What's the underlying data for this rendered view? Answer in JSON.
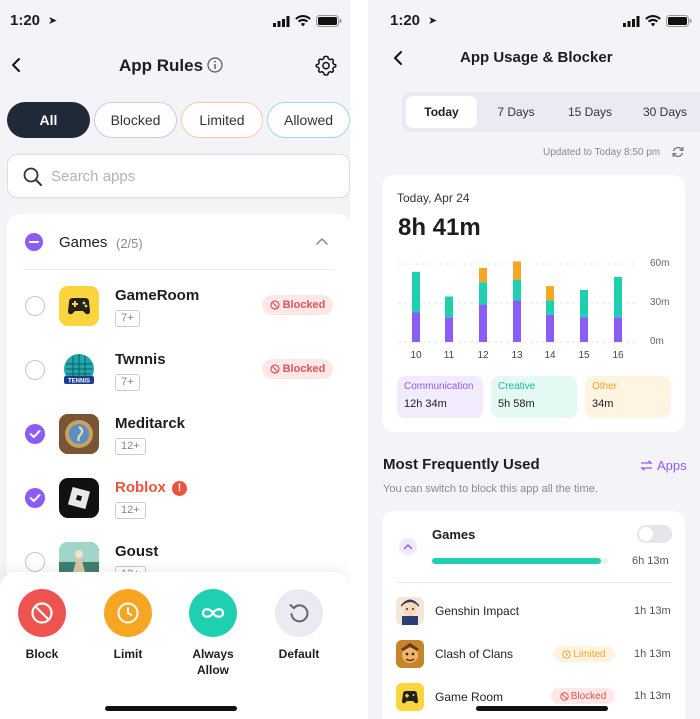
{
  "left": {
    "status_time": "1:20",
    "title": "App Rules",
    "filters": [
      {
        "label": "All",
        "active": true
      },
      {
        "label": "Blocked",
        "active": false
      },
      {
        "label": "Limited",
        "active": false
      },
      {
        "label": "Allowed",
        "active": false
      }
    ],
    "search_placeholder": "Search apps",
    "group": {
      "name": "Games",
      "count": "(2/5)"
    },
    "apps": [
      {
        "name": "GameRoom",
        "age": "7+",
        "checked": false,
        "badge": "Blocked"
      },
      {
        "name": "Twnnis",
        "age": "7+",
        "checked": false,
        "badge": "Blocked"
      },
      {
        "name": "Meditarck",
        "age": "12+",
        "checked": true,
        "badge": ""
      },
      {
        "name": "Roblox",
        "age": "12+",
        "checked": true,
        "badge": ""
      },
      {
        "name": "Goust",
        "age": "12+",
        "checked": false,
        "badge": ""
      }
    ],
    "actions": [
      {
        "label": "Block",
        "color": "#ef5350"
      },
      {
        "label": "Limit",
        "color": "#f5a623"
      },
      {
        "label": "Always Allow",
        "color": "#1fcfb0"
      },
      {
        "label": "Default",
        "color": "#ebeaf3"
      }
    ],
    "colors": {
      "accent": "#8b5cf6",
      "dark_pill": "#1f2937",
      "warning": "#e8543f"
    }
  },
  "right": {
    "status_time": "1:20",
    "title": "App Usage & Blocker",
    "periods": [
      {
        "label": "Today",
        "active": true
      },
      {
        "label": "7 Days",
        "active": false
      },
      {
        "label": "15 Days",
        "active": false
      },
      {
        "label": "30 Days",
        "active": false
      }
    ],
    "updated": "Updated to Today 8:50 pm",
    "summary": {
      "date": "Today, Apr 24",
      "total": "8h 41m"
    },
    "categories": [
      {
        "label": "Communication",
        "value": "12h 34m",
        "color": "#8b5cf6",
        "bg": "#f1ebfd"
      },
      {
        "label": "Creative",
        "value": "5h 58m",
        "color": "#1fcfb0",
        "bg": "#e4f8f4"
      },
      {
        "label": "Other",
        "value": "34m",
        "color": "#f5a623",
        "bg": "#fff3e2"
      }
    ],
    "most_used": {
      "heading": "Most Frequently Used",
      "apps_link": "Apps",
      "subtitle": "You can switch to block this app all the time.",
      "group": {
        "name": "Games",
        "time": "6h 13m",
        "progress": 0.96
      },
      "items": [
        {
          "name": "Genshin Impact",
          "time": "1h 13m",
          "badge": ""
        },
        {
          "name": "Clash of Clans",
          "time": "1h 13m",
          "badge": "Limited"
        },
        {
          "name": "Game Room",
          "time": "1h 13m",
          "badge": "Blocked"
        }
      ]
    }
  },
  "chart_data": {
    "type": "bar",
    "categories": [
      "10",
      "11",
      "12",
      "13",
      "14",
      "15",
      "16"
    ],
    "series": [
      {
        "name": "Communication",
        "values": [
          23,
          19,
          29,
          32,
          21,
          19,
          19
        ],
        "color": "#8b5cf6"
      },
      {
        "name": "Creative",
        "values": [
          31,
          16,
          17,
          16,
          11,
          21,
          31
        ],
        "color": "#1fcfb0"
      },
      {
        "name": "Other",
        "values": [
          0,
          0,
          11,
          14,
          11,
          0,
          0
        ],
        "color": "#f5a623"
      }
    ],
    "y_ticks": [
      "60m",
      "30m",
      "0m"
    ],
    "ylim": [
      0,
      60
    ],
    "grid": true,
    "stacked": true
  }
}
